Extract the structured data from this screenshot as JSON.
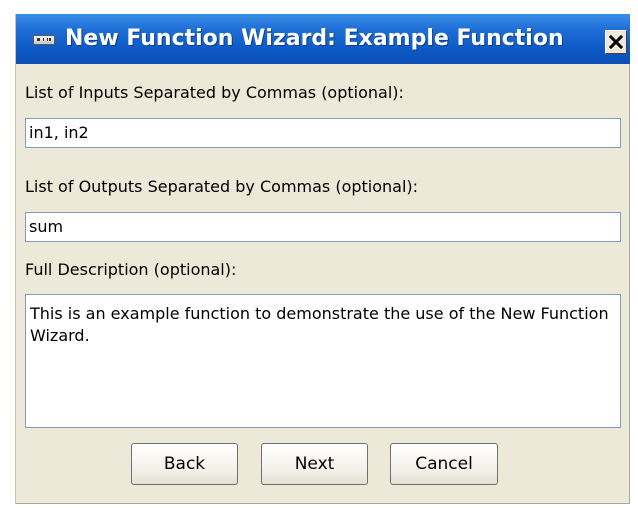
{
  "window": {
    "title": "New Function Wizard: Example Function",
    "title_icon": "ruler-icon",
    "close_icon": "close-icon"
  },
  "inputs": {
    "label": "List of Inputs Separated by Commas (optional):",
    "value": "in1, in2"
  },
  "outputs": {
    "label": "List of Outputs Separated by Commas (optional):",
    "value": "sum"
  },
  "description": {
    "label": "Full Description (optional):",
    "value": "This is an example function to demonstrate the use of the New Function Wizard."
  },
  "buttons": {
    "back": "Back",
    "next": "Next",
    "cancel": "Cancel"
  },
  "colors": {
    "titlebar": "#0f5bc7",
    "dialog_bg": "#ece9d8",
    "field_border": "#7f9db9"
  }
}
